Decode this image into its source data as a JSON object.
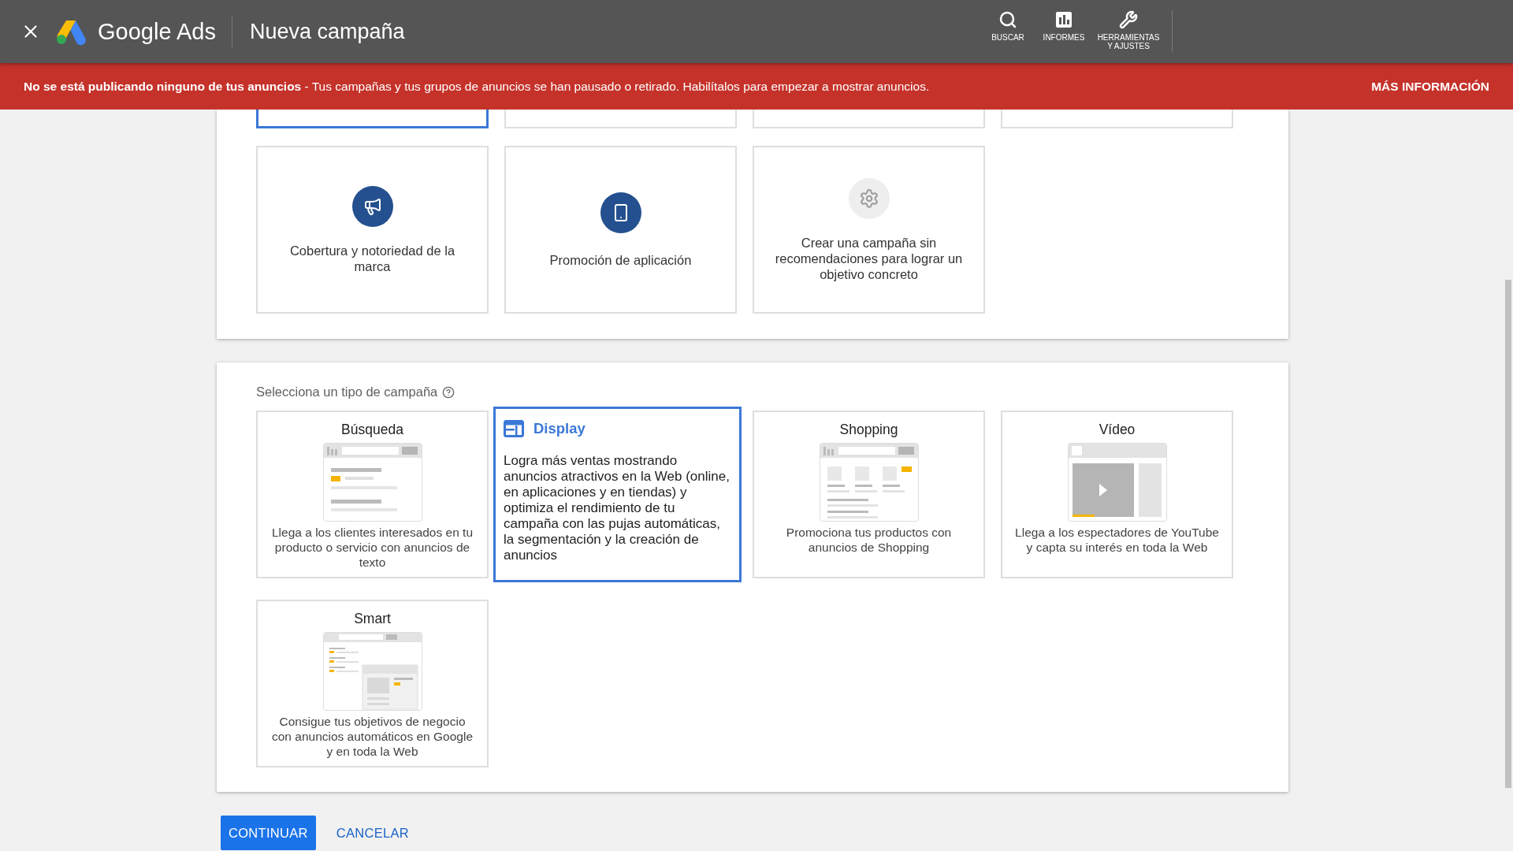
{
  "header": {
    "brand": "Google Ads",
    "title": "Nueva campaña",
    "actions": [
      {
        "kind": "search",
        "label": "BUSCAR"
      },
      {
        "kind": "reports",
        "label": "INFORMES"
      },
      {
        "kind": "tools",
        "label": "HERRAMIENTAS Y AJUSTES"
      }
    ]
  },
  "banner": {
    "message": "**No se está publicando ninguno de tus anuncios** - Tus campañas y tus grupos de anuncios se han pausado o retirado. Habilítalos para empezar a mostrar anuncios.",
    "link": "MÁS INFORMACIÓN"
  },
  "objectives": [
    {
      "kind": "cut",
      "selected": true
    },
    {
      "kind": "cut",
      "selected": false
    },
    {
      "kind": "cut",
      "selected": false
    },
    {
      "kind": "cut",
      "selected": false
    },
    {
      "kind": "megaphone",
      "label": "Cobertura y notoriedad de la marca",
      "selected": false
    },
    {
      "kind": "phone",
      "label": "Promoción de aplicación",
      "selected": false
    },
    {
      "kind": "gear",
      "label": "Crear una campaña sin recomendaciones para lograr un objetivo concreto",
      "selected": false
    }
  ],
  "campaigns": {
    "label": "Selecciona un tipo de campaña",
    "types": [
      {
        "kind": "search",
        "title": "Búsqueda",
        "description": "Llega a los clientes interesados en tu producto o servicio con anuncios de texto",
        "selected": false
      },
      {
        "kind": "display",
        "title": "Display",
        "description": "Logra más ventas mostrando anuncios atractivos en la Web (online, en aplicaciones y en tiendas) y optimiza el rendimiento de tu campaña con las pujas automáticas, la segmentación y la creación de anuncios",
        "selected": true
      },
      {
        "kind": "shopping",
        "title": "Shopping",
        "description": "Promociona tus productos con anuncios de Shopping",
        "selected": false
      },
      {
        "kind": "video",
        "title": "Vídeo",
        "description": "Llega a los espectadores de YouTube y capta su interés en toda la Web",
        "selected": false
      },
      {
        "kind": "smart",
        "title": "Smart",
        "description": "Consigue tus objetivos de negocio con anuncios automáticos en Google y en toda la Web",
        "selected": false
      }
    ]
  },
  "buttons": [
    {
      "kind": "primary",
      "label": "CONTINUAR"
    },
    {
      "kind": "text",
      "label": "CANCELAR"
    }
  ]
}
